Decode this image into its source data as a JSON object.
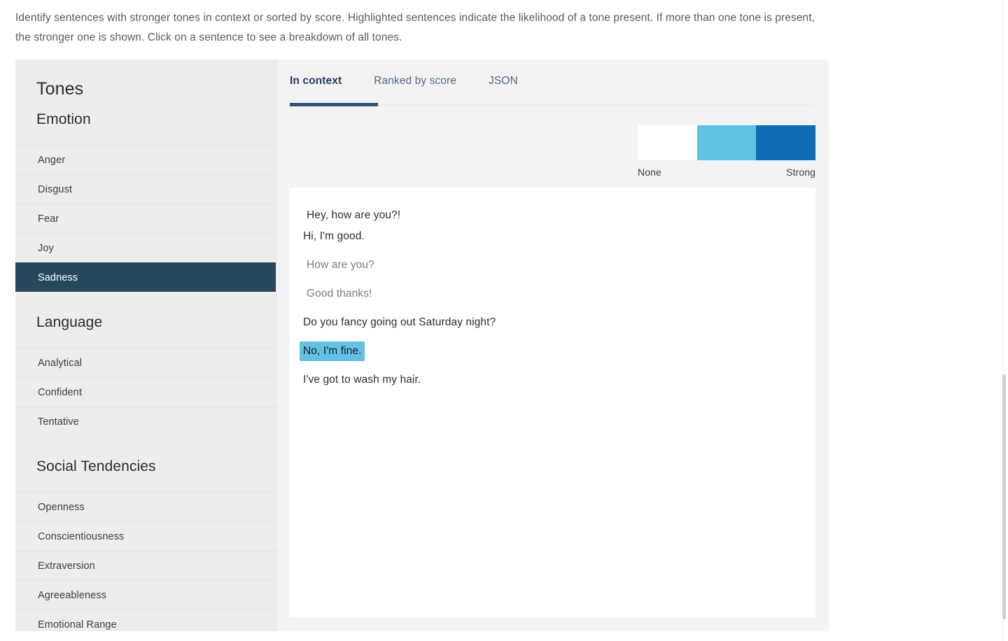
{
  "intro": {
    "text": "Identify sentences with stronger tones in context or sorted by score. Highlighted sentences indicate the likelihood of a tone present. If more than one tone is present, the stronger one is shown. Click on a sentence to see a breakdown of all tones."
  },
  "sidebar": {
    "title": "Tones",
    "groups": [
      {
        "label": "Emotion",
        "items": [
          {
            "label": "Anger",
            "selected": false
          },
          {
            "label": "Disgust",
            "selected": false
          },
          {
            "label": "Fear",
            "selected": false
          },
          {
            "label": "Joy",
            "selected": false
          },
          {
            "label": "Sadness",
            "selected": true
          }
        ]
      },
      {
        "label": "Language",
        "items": [
          {
            "label": "Analytical",
            "selected": false
          },
          {
            "label": "Confident",
            "selected": false
          },
          {
            "label": "Tentative",
            "selected": false
          }
        ]
      },
      {
        "label": "Social Tendencies",
        "items": [
          {
            "label": "Openness",
            "selected": false
          },
          {
            "label": "Conscientiousness",
            "selected": false
          },
          {
            "label": "Extraversion",
            "selected": false
          },
          {
            "label": "Agreeableness",
            "selected": false
          },
          {
            "label": "Emotional Range",
            "selected": false
          }
        ]
      }
    ]
  },
  "main": {
    "tabs": [
      {
        "label": "In context",
        "active": true
      },
      {
        "label": "Ranked by score",
        "active": false
      },
      {
        "label": "JSON",
        "active": false
      }
    ],
    "legend": {
      "low_label": "None",
      "high_label": "Strong",
      "segments": [
        "#ffffff",
        "#62c2e3",
        "#0f6cb4"
      ]
    },
    "sentences": [
      {
        "text": "Hey, how are you?!",
        "indented": true,
        "muted": false,
        "highlight": "none"
      },
      {
        "text": "Hi, I'm good.",
        "indented": false,
        "muted": false,
        "highlight": "none"
      },
      {
        "text": "How are you?",
        "indented": true,
        "muted": true,
        "highlight": "none"
      },
      {
        "text": "Good thanks!",
        "indented": true,
        "muted": true,
        "highlight": "none"
      },
      {
        "text": "Do you fancy going out Saturday night?",
        "indented": false,
        "muted": false,
        "highlight": "none"
      },
      {
        "text": "No, I'm fine.",
        "indented": false,
        "muted": false,
        "highlight": "strong"
      },
      {
        "text": "I've got to wash my hair.",
        "indented": false,
        "muted": false,
        "highlight": "none"
      }
    ]
  },
  "colors": {
    "selected_nav": "#28495c",
    "tab_active": "#1f3d63",
    "tab_underline": "#2b5480",
    "highlight_strong": "#62c2e3",
    "legend_dark": "#0f6cb4",
    "sidebar_bg": "#ededee",
    "panel_bg": "#f3f3f4"
  }
}
